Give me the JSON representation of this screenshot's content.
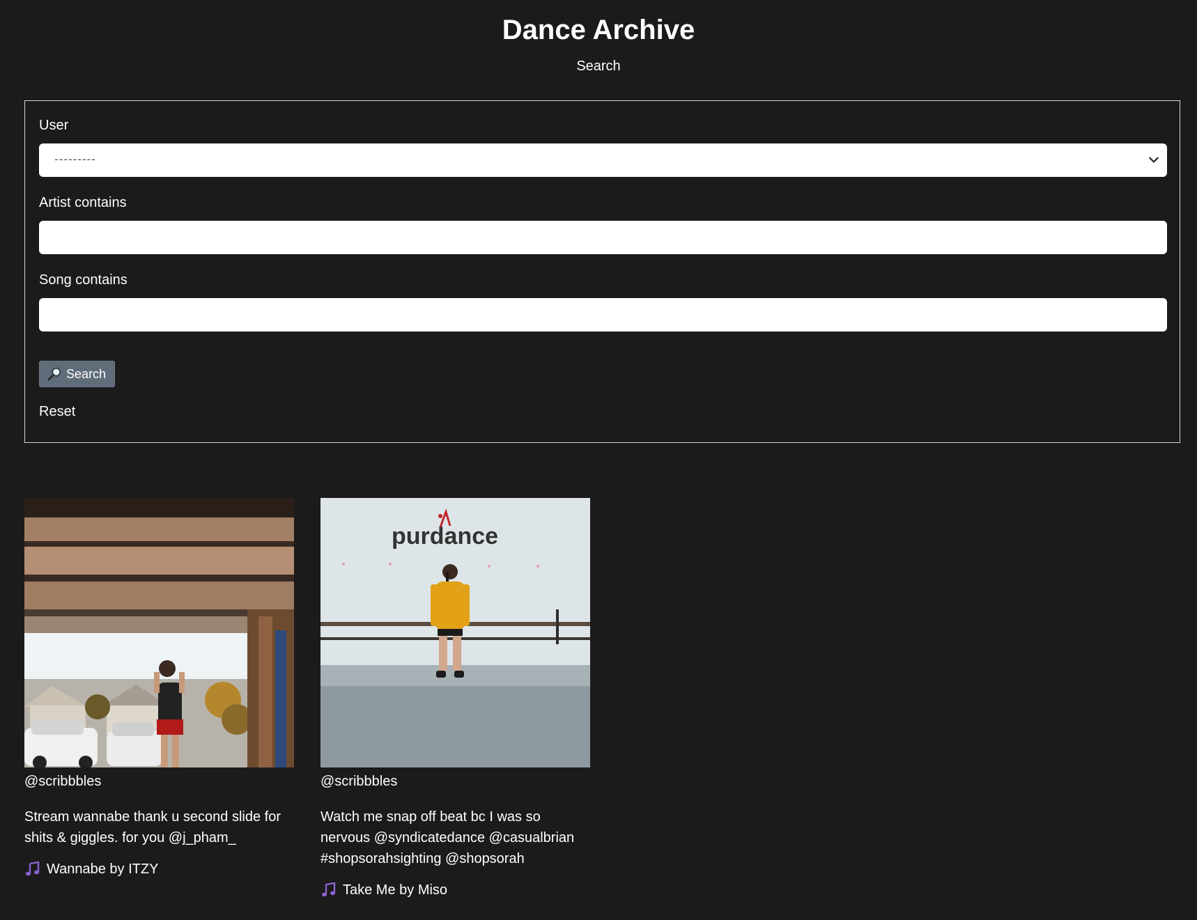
{
  "header": {
    "title": "Dance Archive",
    "subtitle": "Search"
  },
  "form": {
    "user_label": "User",
    "user_selected": "---------",
    "artist_label": "Artist contains",
    "artist_value": "",
    "song_label": "Song contains",
    "song_value": "",
    "search_button": "Search",
    "reset_link": "Reset"
  },
  "icons": {
    "search": "magnifier-icon",
    "select": "chevron-down-icon",
    "music": "music-note-icon"
  },
  "colors": {
    "background": "#1c1b1c",
    "search_button": "#5f6c79",
    "music_note": "#8a63d2"
  },
  "videos": [
    {
      "username": "@scribbbles",
      "caption": "Stream wannabe thank u second slide for shits & giggles. for you @j_pham_",
      "song": "Wannabe by ITZY"
    },
    {
      "username": "@scribbbles",
      "caption": "Watch me snap off beat bc I was so nervous @syndicatedance @casualbrian #shopsorahsighting @shopsorah",
      "song": "Take Me by Miso",
      "studio_logo": "purdance"
    }
  ]
}
